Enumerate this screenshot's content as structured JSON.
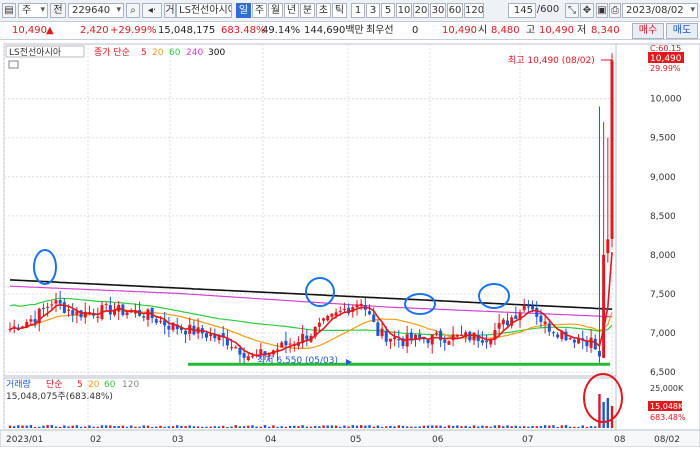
{
  "toolbar": {
    "period_label": "주",
    "jeon_label": "전",
    "code": "229640",
    "name": "LS전선아시아",
    "timeframes": [
      "일",
      "주",
      "월",
      "년",
      "분",
      "초",
      "틱"
    ],
    "active_timeframe": "일",
    "minute_steps": [
      "1",
      "3",
      "5",
      "10",
      "20",
      "30",
      "60",
      "120"
    ],
    "count": "145",
    "count_total": "/600",
    "date": "2023/08/02"
  },
  "quote": {
    "price": "10,490",
    "change": "2,420",
    "change_rate": "+29.99%",
    "volume": "15,048,175",
    "volume_rate": "683.48%",
    "turnover": "49.14%",
    "amount": "144,690백만",
    "pref_label": "최우선",
    "pref_val": "0",
    "pref_price": "10,490",
    "open_label": "시",
    "open": "8,480",
    "high_label": "고",
    "high": "10,490",
    "low_label": "저",
    "low": "8,340",
    "buy_label": "매수",
    "sell_label": "매도"
  },
  "price_panel": {
    "series_name": "LS전선아시아",
    "ma_label": "종가 단순",
    "ma_periods": [
      "5",
      "20",
      "60",
      "240",
      "300"
    ],
    "high_annotation": "최고 10,490 (08/02)",
    "low_annotation": "최저 6,550 (05/03)",
    "last_tag_top": "C:60.15",
    "last_price_tag": "10,490",
    "last_pct_tag": "29.99%"
  },
  "volume_panel": {
    "label": "거래량",
    "ma_label": "단순",
    "ma_periods": [
      "5",
      "20",
      "60",
      "120"
    ],
    "summary": "15,048,075주(683.48%)",
    "axis_top": "25,000K",
    "last_tag": "15,048K",
    "last_pct": "683.48%"
  },
  "chart_data": {
    "type": "candlestick",
    "y_ticks": [
      6500,
      7000,
      7500,
      8000,
      8500,
      9000,
      9500,
      10000
    ],
    "ylim": [
      6450,
      10700
    ],
    "x_ticks": [
      "2023/01",
      "02",
      "03",
      "04",
      "05",
      "06",
      "07",
      "08",
      "08/02"
    ],
    "ma_colors": {
      "ma5": "#e0191f",
      "ma20": "#f39c12",
      "ma60": "#2ecc40",
      "ma240": "#d63fd6",
      "ma300": "#111111"
    },
    "trendline_support": 6600,
    "annotations_colors": {
      "circle": "#1a73e8",
      "support": "#22bb33",
      "volume_circle": "#e0191f"
    }
  }
}
